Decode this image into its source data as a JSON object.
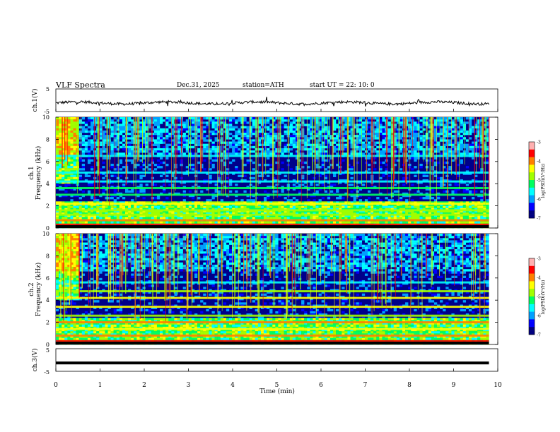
{
  "header": {
    "title": "VLF  Spectra",
    "date": "Dec.31, 2025",
    "station": "station=ATH",
    "start": "start  UT  =   22: 10: 0"
  },
  "chart_data": [
    {
      "type": "line",
      "panel": "ch1-waveform",
      "ylabel": "ch.1(V)",
      "ylim": [
        -5,
        5
      ],
      "yticks": [
        "5",
        "-5"
      ],
      "xlim": [
        0,
        10
      ],
      "color": "#000000"
    },
    {
      "type": "heatmap",
      "panel": "ch1-spectrogram",
      "ylabel": [
        "ch.1",
        "Frequency  (kHz)"
      ],
      "ylim": [
        0,
        10
      ],
      "yticks": [
        "0",
        "2",
        "4",
        "6",
        "8",
        "10"
      ],
      "xlim": [
        0,
        10
      ],
      "data_end_min": 9.8,
      "colorbar": {
        "label": "log(PSD)(V²/Hz)",
        "range": [
          -7,
          -3
        ],
        "ticks": [
          "-3",
          "-4",
          "-5",
          "-6",
          "-7"
        ]
      },
      "bands_khz": [
        {
          "f": 0.3,
          "level": -3.5
        },
        {
          "f": 0.7,
          "level": -4.2
        },
        {
          "f": 1.2,
          "level": -4.8
        },
        {
          "f": 1.6,
          "level": -5.0
        },
        {
          "f": 2.2,
          "level": -4.6
        },
        {
          "f": 3.0,
          "level": -5.2
        },
        {
          "f": 3.6,
          "level": -5.3
        },
        {
          "f": 4.2,
          "level": -5.6
        },
        {
          "f": 5.0,
          "level": -5.5
        },
        {
          "f": 6.5,
          "level": -5.6
        }
      ]
    },
    {
      "type": "heatmap",
      "panel": "ch2-spectrogram",
      "ylabel": [
        "ch.2",
        "Frequency  (kHz)"
      ],
      "ylim": [
        0,
        10
      ],
      "yticks": [
        "0",
        "2",
        "4",
        "6",
        "8",
        "10"
      ],
      "xlim": [
        0,
        10
      ],
      "data_end_min": 9.8,
      "colorbar": {
        "label": "log(PSD)(V²/Hz)",
        "range": [
          -7,
          -3
        ],
        "ticks": [
          "-3",
          "-4",
          "-5",
          "-6",
          "-7"
        ]
      },
      "bands_khz": [
        {
          "f": 0.3,
          "level": -3.6
        },
        {
          "f": 0.8,
          "level": -4.0
        },
        {
          "f": 1.4,
          "level": -4.6
        },
        {
          "f": 2.0,
          "level": -4.1
        },
        {
          "f": 2.6,
          "level": -4.7
        },
        {
          "f": 3.4,
          "level": -4.3
        },
        {
          "f": 4.2,
          "level": -4.6
        },
        {
          "f": 4.8,
          "level": -4.8
        },
        {
          "f": 5.6,
          "level": -5.6
        }
      ]
    },
    {
      "type": "line",
      "panel": "ch3-waveform",
      "ylabel": "ch.3(V)",
      "ylim": [
        -5,
        5
      ],
      "yticks": [
        "5",
        "-5"
      ],
      "xlim": [
        0,
        10
      ],
      "values_level": -1.3,
      "color": "#000000"
    }
  ],
  "xaxis": {
    "label": "Time  (min)",
    "ticks": [
      "0",
      "1",
      "2",
      "3",
      "4",
      "5",
      "6",
      "7",
      "8",
      "9",
      "10"
    ]
  },
  "colormap": [
    "#000080",
    "#0000ff",
    "#00a0ff",
    "#00ffff",
    "#00ff60",
    "#a0ff00",
    "#ffff00",
    "#ff8000",
    "#ff0000",
    "#ffb0b0",
    "#ffffff"
  ]
}
